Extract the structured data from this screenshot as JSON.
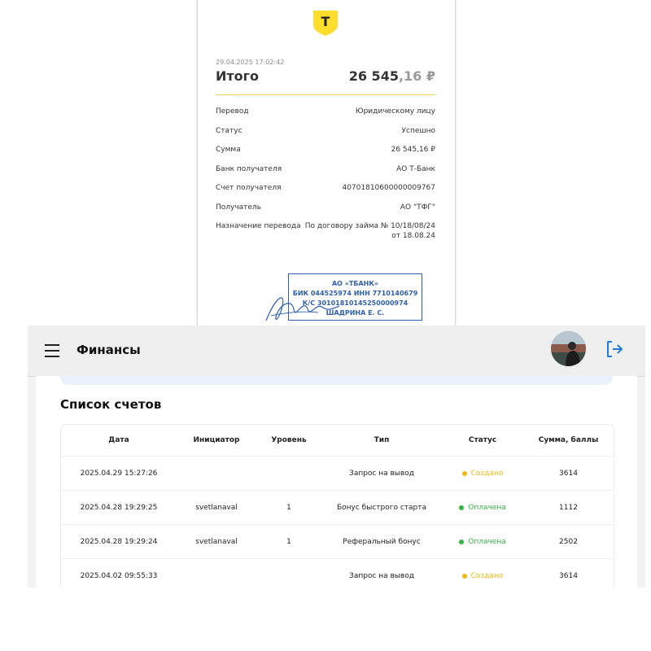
{
  "receipt": {
    "datetime": "29.04.2025 17:02:42",
    "total_label": "Итого",
    "total_main": "26 545",
    "total_kop": ",16 ₽",
    "rows": [
      {
        "label": "Перевод",
        "value": "Юридическому лицу"
      },
      {
        "label": "Статус",
        "value": "Успешно"
      },
      {
        "label": "Сумма",
        "value": "26 545,16 ₽"
      },
      {
        "label": "Банк получателя",
        "value": "АО Т-Банк"
      },
      {
        "label": "Счет получателя",
        "value": "40701810600000009767"
      },
      {
        "label": "Получатель",
        "value": "АО \"ТФГ\""
      },
      {
        "label": "Назначение перевода",
        "value": "По договору займа № 10/18/08/24",
        "value2": "от 18.08.24"
      }
    ],
    "stamp": {
      "line1": "АО «ТБАНК»",
      "line2": "БИК 044525974 ИНН 7710140679",
      "line3": "К/С 30101810145250000974",
      "line4": "ШАДРИНА Е. С."
    },
    "logo_letter": "Т",
    "colors": {
      "accent": "#ffdd2d",
      "stamp": "#2f5fb0"
    }
  },
  "app": {
    "title": "Финансы",
    "icons": {
      "menu": "menu-icon",
      "logout": "logout-icon"
    },
    "section_title": "Список счетов",
    "columns": [
      "Дата",
      "Инициатор",
      "Уровень",
      "Тип",
      "Статус",
      "Сумма, баллы"
    ],
    "rows": [
      {
        "date": "2025.04.29 15:27:26",
        "initiator": "",
        "level": "",
        "type": "Запрос на вывод",
        "status": "Создано",
        "status_color": "#f2b712",
        "amount": "3614"
      },
      {
        "date": "2025.04.28 19:29:25",
        "initiator": "svetlanaval",
        "level": "1",
        "type": "Бонус быстрого старта",
        "status": "Оплачена",
        "status_color": "#34b244",
        "amount": "1112"
      },
      {
        "date": "2025.04.28 19:29:24",
        "initiator": "svetlanaval",
        "level": "1",
        "type": "Реферальный бонус",
        "status": "Оплачена",
        "status_color": "#34b244",
        "amount": "2502"
      },
      {
        "date": "2025.04.02 09:55:33",
        "initiator": "",
        "level": "",
        "type": "Запрос на вывод",
        "status": "Создано",
        "status_color": "#f2b712",
        "amount": "3614"
      }
    ],
    "colors": {
      "created": "#f2b712",
      "paid": "#34b244",
      "logout_icon": "#1e7be0"
    }
  }
}
